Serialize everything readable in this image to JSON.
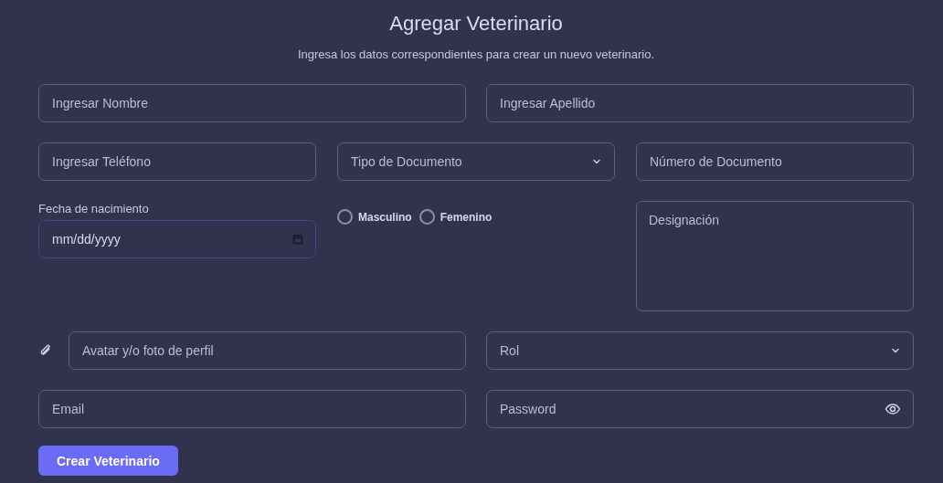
{
  "title": "Agregar Veterinario",
  "subtitle": "Ingresa los datos correspondientes para crear un nuevo veterinario.",
  "rows": [
    {
      "fields": [
        {
          "kind": "text",
          "placeholder": "Ingresar Nombre"
        },
        {
          "kind": "text",
          "placeholder": "Ingresar Apellido"
        }
      ]
    },
    {
      "fields": [
        {
          "kind": "text",
          "placeholder": "Ingresar Teléfono"
        },
        {
          "kind": "select",
          "placeholder": "Tipo de Documento"
        },
        {
          "kind": "text",
          "placeholder": "Número de Documento"
        }
      ]
    },
    {
      "fields": [
        {
          "kind": "date",
          "label": "Fecha de nacimiento",
          "placeholder": "mm/dd/yyyy"
        },
        {
          "kind": "radio",
          "options": [
            {
              "label": "Masculino",
              "selected": false
            },
            {
              "label": "Femenino",
              "selected": false
            }
          ]
        },
        {
          "kind": "textarea",
          "placeholder": "Designación"
        }
      ]
    },
    {
      "fields": [
        {
          "kind": "file",
          "placeholder": "Avatar y/o foto de perfil"
        },
        {
          "kind": "select",
          "placeholder": "Rol"
        }
      ]
    },
    {
      "fields": [
        {
          "kind": "text",
          "placeholder": "Email"
        },
        {
          "kind": "password",
          "placeholder": "Password"
        }
      ]
    }
  ],
  "submit": "Crear Veterinario"
}
